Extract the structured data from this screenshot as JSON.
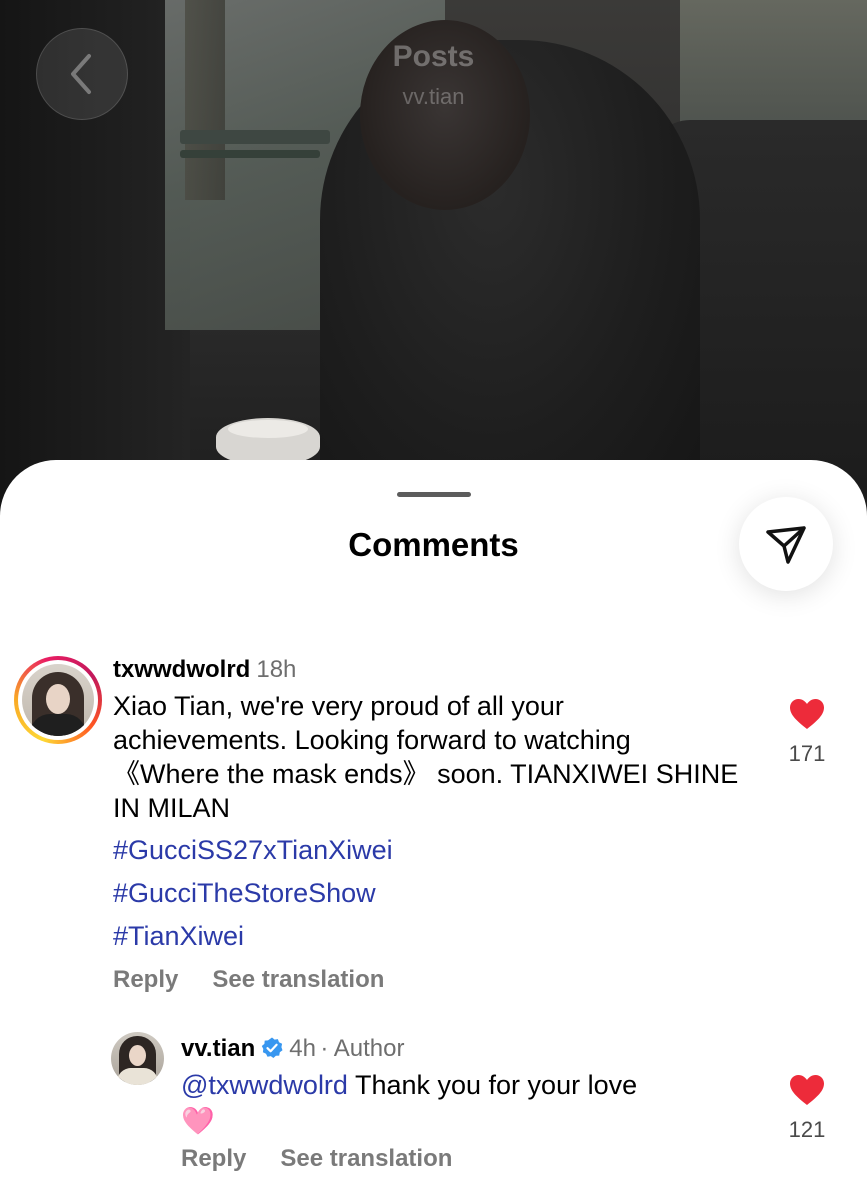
{
  "header": {
    "title": "Posts",
    "subtitle": "vv.tian"
  },
  "sheet": {
    "title": "Comments"
  },
  "comment": {
    "username": "txwwdwolrd",
    "time": "18h",
    "text": "Xiao Tian, we're very proud of all your achievements. Looking forward to watching 《Where the mask ends》 soon. TIANXIWEI SHINE IN MILAN",
    "hashtags": [
      "#GucciSS27xTianXiwei",
      "#GucciTheStoreShow",
      "#TianXiwei"
    ],
    "reply_label": "Reply",
    "translate_label": "See translation",
    "likes": "171"
  },
  "reply": {
    "username": "vv.tian",
    "time": "4h",
    "author_label": "· Author",
    "mention": "@txwwdwolrd",
    "text": " Thank you for your love",
    "emoji": "🩷",
    "reply_label": "Reply",
    "translate_label": "See translation",
    "likes": "121"
  },
  "colors": {
    "like": "#ed2b3a",
    "link": "#2b3aa8",
    "verified": "#3897f0"
  }
}
